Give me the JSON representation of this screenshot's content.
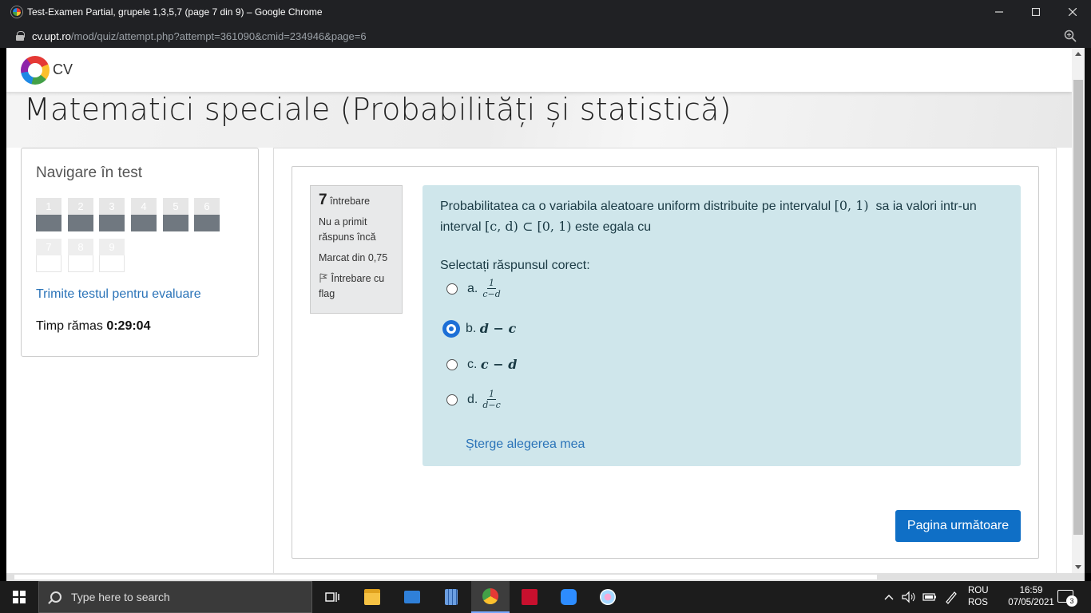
{
  "browser": {
    "window_title": "Test-Examen Partial, grupele 1,3,5,7 (page 7 din 9) – Google Chrome",
    "url_domain": "cv.upt.ro",
    "url_path": "/mod/quiz/attempt.php?attempt=361090&cmid=234946&page=6"
  },
  "site": {
    "logo_text": "CV",
    "course_title": "Matematici speciale (Probabilități și statistică)"
  },
  "nav": {
    "title": "Navigare în test",
    "questions": [
      {
        "label": "1",
        "state": "answered"
      },
      {
        "label": "2",
        "state": "answered"
      },
      {
        "label": "3",
        "state": "answered"
      },
      {
        "label": "4",
        "state": "answered"
      },
      {
        "label": "5",
        "state": "answered"
      },
      {
        "label": "6",
        "state": "answered"
      },
      {
        "label": "7",
        "state": "unanswered"
      },
      {
        "label": "8",
        "state": "unanswered"
      },
      {
        "label": "9",
        "state": "unanswered"
      }
    ],
    "submit_link": "Trimite testul pentru evaluare",
    "timer_label": "Timp rămas",
    "timer_value": "0:29:04"
  },
  "question": {
    "number": "7",
    "number_label": "întrebare",
    "status": "Nu a primit răspuns încă",
    "marks": "Marcat din 0,75",
    "flag_label": "Întrebare cu flag",
    "text_part1": "Probabilitatea ca o variabila aleatoare uniform distribuite pe intervalul",
    "interval1": "[0, 1)",
    "text_part2": "sa ia valori intr-un interval",
    "interval2": "[c, d) ⊂ [0, 1)",
    "text_part3": "este egala cu",
    "prompt": "Selectați răspunsul corect:",
    "options": [
      {
        "letter": "a.",
        "numerator": "1",
        "denominator": "c−d",
        "selected": false
      },
      {
        "letter": "b.",
        "expr": "d − c",
        "selected": true
      },
      {
        "letter": "c.",
        "expr": "c − d",
        "selected": false
      },
      {
        "letter": "d.",
        "numerator": "1",
        "denominator": "d−c",
        "selected": false
      }
    ],
    "clear_link": "Șterge alegerea mea"
  },
  "next_button": "Pagina următoare",
  "taskbar": {
    "search_placeholder": "Type here to search",
    "lang_top": "ROU",
    "lang_bottom": "ROS",
    "time": "16:59",
    "date": "07/05/2021",
    "notification_count": "3"
  },
  "colors": {
    "accent": "#0f6fc6",
    "question_bg": "#cfe6eb",
    "link": "#2a73b8"
  }
}
